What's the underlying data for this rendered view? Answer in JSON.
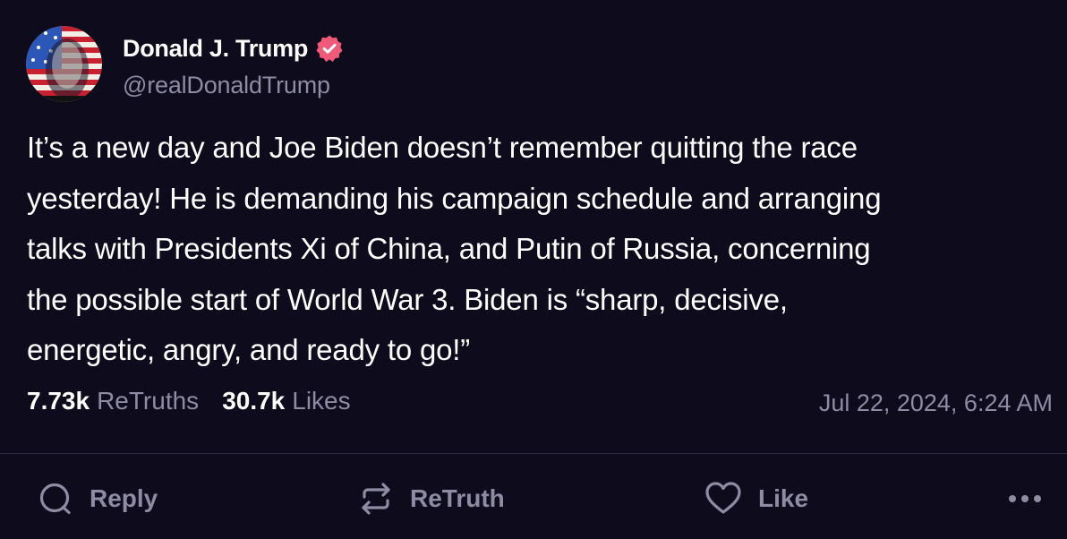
{
  "author": {
    "display_name": "Donald J. Trump",
    "handle": "@realDonaldTrump",
    "verified_icon": "verified-badge-icon",
    "avatar_icon": "profile-avatar"
  },
  "post": {
    "text": "It’s a new day and Joe Biden doesn’t remember quitting the race\nyesterday! He is demanding his campaign schedule and arranging\ntalks with Presidents Xi of China, and Putin of Russia, concerning\nthe possible start of World War 3. Biden is “sharp, decisive,\nenergetic, angry, and ready to go!”",
    "timestamp": "Jul 22, 2024, 6:24 AM"
  },
  "stats": {
    "retruths_count": "7.73k",
    "retruths_label": "ReTruths",
    "likes_count": "30.7k",
    "likes_label": "Likes"
  },
  "actions": {
    "reply_label": "Reply",
    "retruth_label": "ReTruth",
    "like_label": "Like",
    "more_icon": "more-dots-icon"
  },
  "colors": {
    "background": "#0e0b1c",
    "text_primary": "#ffffff",
    "text_secondary": "#8e8ca3",
    "verified_badge": "#f05a78",
    "divider": "#2a2740"
  }
}
